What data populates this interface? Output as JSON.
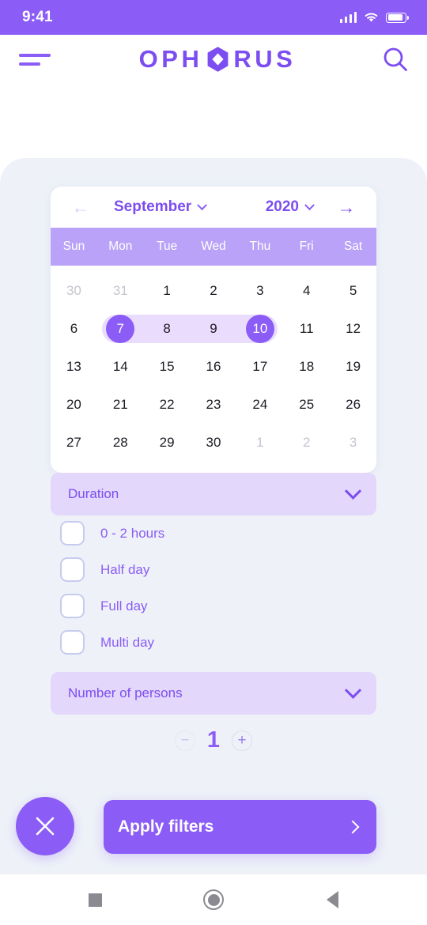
{
  "status_bar": {
    "time": "9:41",
    "signal_icon": "cellular-bars-icon",
    "wifi_icon": "wifi-icon",
    "battery_icon": "battery-icon"
  },
  "header": {
    "menu_icon": "hamburger-menu-icon",
    "brand_left": "OPH",
    "brand_right": "RUS",
    "brand_mark_icon": "hexagon-logo-icon",
    "search_icon": "search-icon"
  },
  "calendar": {
    "prev_icon": "arrow-left-icon",
    "next_icon": "arrow-right-icon",
    "month": "September",
    "year": "2020",
    "month_chevron_icon": "chevron-down-icon",
    "year_chevron_icon": "chevron-down-icon",
    "weekdays": [
      "Sun",
      "Mon",
      "Tue",
      "Wed",
      "Thu",
      "Fri",
      "Sat"
    ],
    "weeks": [
      [
        {
          "d": "30",
          "state": "muted"
        },
        {
          "d": "31",
          "state": "muted"
        },
        {
          "d": "1",
          "state": "normal"
        },
        {
          "d": "2",
          "state": "normal"
        },
        {
          "d": "3",
          "state": "normal"
        },
        {
          "d": "4",
          "state": "normal"
        },
        {
          "d": "5",
          "state": "normal"
        }
      ],
      [
        {
          "d": "6",
          "state": "normal"
        },
        {
          "d": "7",
          "state": "range-start"
        },
        {
          "d": "8",
          "state": "in-range"
        },
        {
          "d": "9",
          "state": "in-range"
        },
        {
          "d": "10",
          "state": "range-end"
        },
        {
          "d": "11",
          "state": "normal"
        },
        {
          "d": "12",
          "state": "normal"
        }
      ],
      [
        {
          "d": "13",
          "state": "normal"
        },
        {
          "d": "14",
          "state": "normal"
        },
        {
          "d": "15",
          "state": "normal"
        },
        {
          "d": "16",
          "state": "normal"
        },
        {
          "d": "17",
          "state": "normal"
        },
        {
          "d": "18",
          "state": "normal"
        },
        {
          "d": "19",
          "state": "normal"
        }
      ],
      [
        {
          "d": "20",
          "state": "normal"
        },
        {
          "d": "21",
          "state": "normal"
        },
        {
          "d": "22",
          "state": "normal"
        },
        {
          "d": "23",
          "state": "normal"
        },
        {
          "d": "24",
          "state": "normal"
        },
        {
          "d": "25",
          "state": "normal"
        },
        {
          "d": "26",
          "state": "normal"
        }
      ],
      [
        {
          "d": "27",
          "state": "normal"
        },
        {
          "d": "28",
          "state": "normal"
        },
        {
          "d": "29",
          "state": "normal"
        },
        {
          "d": "30",
          "state": "normal"
        },
        {
          "d": "1",
          "state": "muted"
        },
        {
          "d": "2",
          "state": "muted"
        },
        {
          "d": "3",
          "state": "muted"
        }
      ]
    ],
    "selected_range": {
      "start": "7",
      "end": "10"
    }
  },
  "duration": {
    "title": "Duration",
    "chevron_icon": "chevron-down-icon",
    "options": [
      {
        "label": "0 - 2 hours",
        "checked": false
      },
      {
        "label": "Half day",
        "checked": false
      },
      {
        "label": "Full day",
        "checked": false
      },
      {
        "label": "Multi day",
        "checked": false
      }
    ]
  },
  "persons": {
    "title": "Number of persons",
    "chevron_icon": "chevron-down-icon",
    "decrement_label": "−",
    "increment_label": "+",
    "value": "1"
  },
  "actions": {
    "close_icon": "close-x-icon",
    "apply_label": "Apply filters",
    "apply_chevron_icon": "chevron-right-icon"
  },
  "nav_bar": {
    "recents_icon": "square-recents-icon",
    "home_icon": "circle-home-icon",
    "back_icon": "triangle-back-icon"
  },
  "colors": {
    "primary": "#8B5CF6",
    "brand": "#7C4DF0",
    "weekday_header": "#B9A2F8",
    "section_bg": "#E3D7FB",
    "range_band": "#EADCFD",
    "panel_bg": "#EEF2F8"
  }
}
